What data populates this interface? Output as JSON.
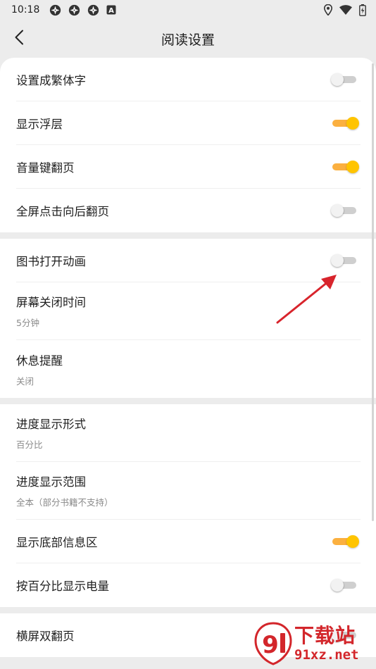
{
  "status_bar": {
    "time": "10:18",
    "left_icons": [
      "spinner-icon",
      "spinner-icon",
      "spinner-icon",
      "app-a-icon"
    ],
    "app_badge": "A",
    "right_icons": [
      "location-icon",
      "wifi-icon",
      "battery-icon"
    ]
  },
  "header": {
    "title": "阅读设置",
    "back_icon": "chevron-left-icon"
  },
  "groups": [
    {
      "rows": [
        {
          "label": "设置成繁体字",
          "toggle": false
        },
        {
          "label": "显示浮层",
          "toggle": true
        },
        {
          "label": "音量键翻页",
          "toggle": true
        },
        {
          "label": "全屏点击向后翻页",
          "toggle": false
        }
      ]
    },
    {
      "rows": [
        {
          "label": "图书打开动画",
          "toggle": false
        },
        {
          "label": "屏幕关闭时间",
          "value": "5分钟"
        },
        {
          "label": "休息提醒",
          "value": "关闭"
        }
      ]
    },
    {
      "rows": [
        {
          "label": "进度显示形式",
          "value": "百分比"
        },
        {
          "label": "进度显示范围",
          "value": "全本（部分书籍不支持）"
        },
        {
          "label": "显示底部信息区",
          "toggle": true
        },
        {
          "label": "按百分比显示电量",
          "toggle": false
        }
      ]
    },
    {
      "rows": [
        {
          "label": "横屏双翻页",
          "toggle": false
        }
      ]
    }
  ],
  "watermark": {
    "logo_digits": "9",
    "text_cn": "下载站",
    "text_url": "91xz.net"
  },
  "colors": {
    "toggle_on_track": "#fbb040",
    "toggle_on_knob": "#ffc400",
    "toggle_off_track": "#cfcfcf",
    "annotation_arrow": "#d8242c",
    "watermark_red": "#d3262b"
  }
}
